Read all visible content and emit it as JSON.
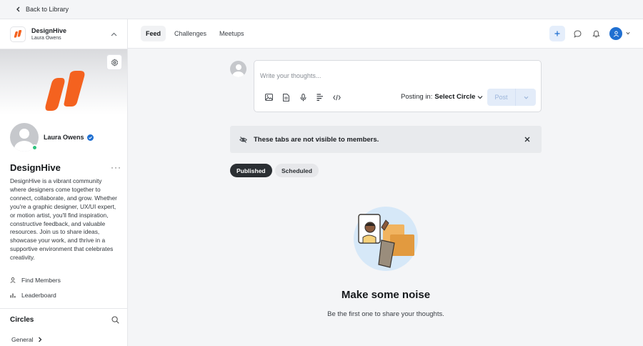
{
  "topbar": {
    "back_label": "Back to Library"
  },
  "sidebar": {
    "brand_name": "DesignHive",
    "brand_owner": "Laura Owens",
    "profile_name": "Laura Owens",
    "community_title": "DesignHive",
    "more_label": "···",
    "description": "DesignHive is a vibrant community where designers come together to connect, collaborate, and grow. Whether you're a graphic designer, UX/UI expert, or motion artist, you'll find inspiration, constructive feedback, and valuable resources. Join us to share ideas, showcase your work, and thrive in a supportive environment that celebrates creativity.",
    "links": [
      {
        "label": "Find Members"
      },
      {
        "label": "Leaderboard"
      }
    ],
    "circles_title": "Circles",
    "circles": [
      {
        "label": "General"
      }
    ]
  },
  "header": {
    "tabs": [
      {
        "label": "Feed",
        "active": true
      },
      {
        "label": "Challenges",
        "active": false
      },
      {
        "label": "Meetups",
        "active": false
      }
    ]
  },
  "composer": {
    "placeholder": "Write your thoughts...",
    "posting_in_label": "Posting in:",
    "circle_value": "Select Circle",
    "post_label": "Post"
  },
  "notice": {
    "text": "These tabs are not visible to members."
  },
  "filters": [
    {
      "label": "Published",
      "active": true
    },
    {
      "label": "Scheduled",
      "active": false
    }
  ],
  "empty_state": {
    "title": "Make some noise",
    "subtitle": "Be the first one to share your thoughts."
  },
  "colors": {
    "brand_orange": "#f4621f",
    "accent_blue": "#1f6fd1",
    "online_green": "#2ec27e",
    "illustration_bg": "#d6e8f8"
  }
}
